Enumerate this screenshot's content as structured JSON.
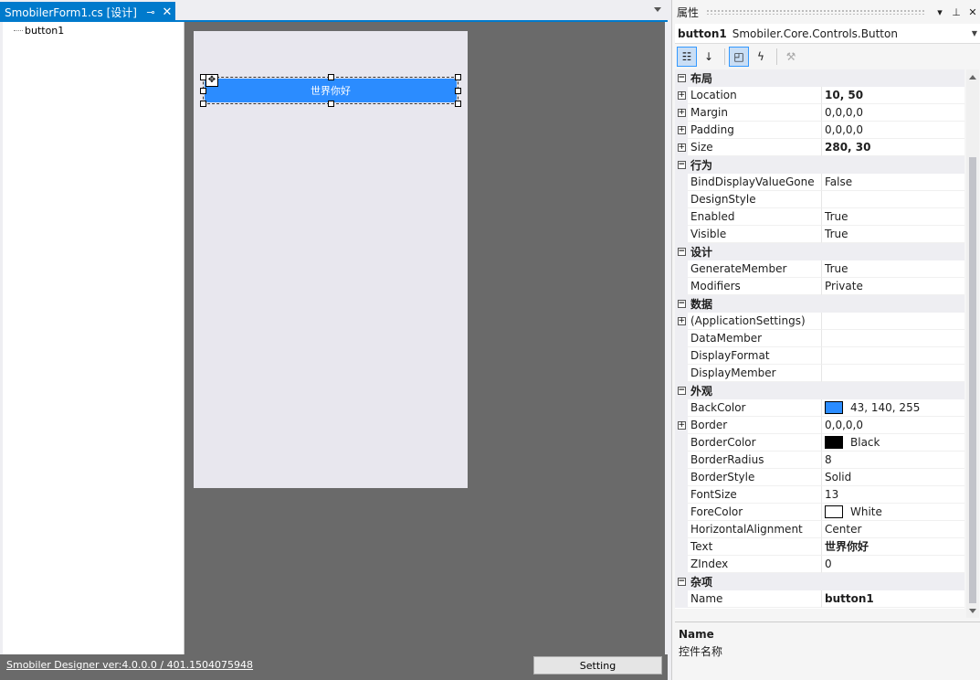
{
  "document_tab": {
    "title": "SmobilerForm1.cs [设计]",
    "pin_icon": "pin-icon",
    "close_icon": "close-icon"
  },
  "tree": {
    "items": [
      "button1"
    ]
  },
  "designer": {
    "button_text": "世界你好",
    "button_color": "#2b8cff",
    "canvas_color": "#6a6a6a",
    "form_color": "#e8e7ee"
  },
  "status_bar": {
    "version": "Smobiler Designer ver:4.0.0.0 / 401.1504075948",
    "setting_label": "Setting"
  },
  "properties_panel": {
    "title": "属性",
    "object_name": "button1",
    "object_type": "Smobiler.Core.Controls.Button",
    "categories": [
      {
        "label": "布局",
        "rows": [
          {
            "name": "Location",
            "value": "10, 50",
            "expandable": true,
            "bold": true
          },
          {
            "name": "Margin",
            "value": "0,0,0,0",
            "expandable": true,
            "bold": false
          },
          {
            "name": "Padding",
            "value": "0,0,0,0",
            "expandable": true,
            "bold": false
          },
          {
            "name": "Size",
            "value": "280, 30",
            "expandable": true,
            "bold": true
          }
        ]
      },
      {
        "label": "行为",
        "rows": [
          {
            "name": "BindDisplayValueGone",
            "value": "False"
          },
          {
            "name": "DesignStyle",
            "value": ""
          },
          {
            "name": "Enabled",
            "value": "True"
          },
          {
            "name": "Visible",
            "value": "True"
          }
        ]
      },
      {
        "label": "设计",
        "rows": [
          {
            "name": "GenerateMember",
            "value": "True"
          },
          {
            "name": "Modifiers",
            "value": "Private"
          }
        ]
      },
      {
        "label": "数据",
        "rows": [
          {
            "name": "(ApplicationSettings)",
            "value": ""
          },
          {
            "name": "DataMember",
            "value": ""
          },
          {
            "name": "DisplayFormat",
            "value": ""
          },
          {
            "name": "DisplayMember",
            "value": ""
          }
        ]
      },
      {
        "label": "外观",
        "rows": [
          {
            "name": "BackColor",
            "value": "43, 140, 255"
          },
          {
            "name": "Border",
            "value": "0,0,0,0"
          },
          {
            "name": "BorderColor",
            "value": "Black"
          },
          {
            "name": "BorderRadius",
            "value": "8"
          },
          {
            "name": "BorderStyle",
            "value": "Solid"
          },
          {
            "name": "FontSize",
            "value": "13"
          },
          {
            "name": "ForeColor",
            "value": "White"
          },
          {
            "name": "HorizontalAlignment",
            "value": "Center"
          },
          {
            "name": "Text",
            "value": "世界你好"
          },
          {
            "name": "ZIndex",
            "value": "0"
          }
        ]
      },
      {
        "label": "杂项",
        "rows": [
          {
            "name": "Name",
            "value": "button1"
          }
        ]
      }
    ],
    "description": {
      "title": "Name",
      "text": "控件名称"
    }
  }
}
